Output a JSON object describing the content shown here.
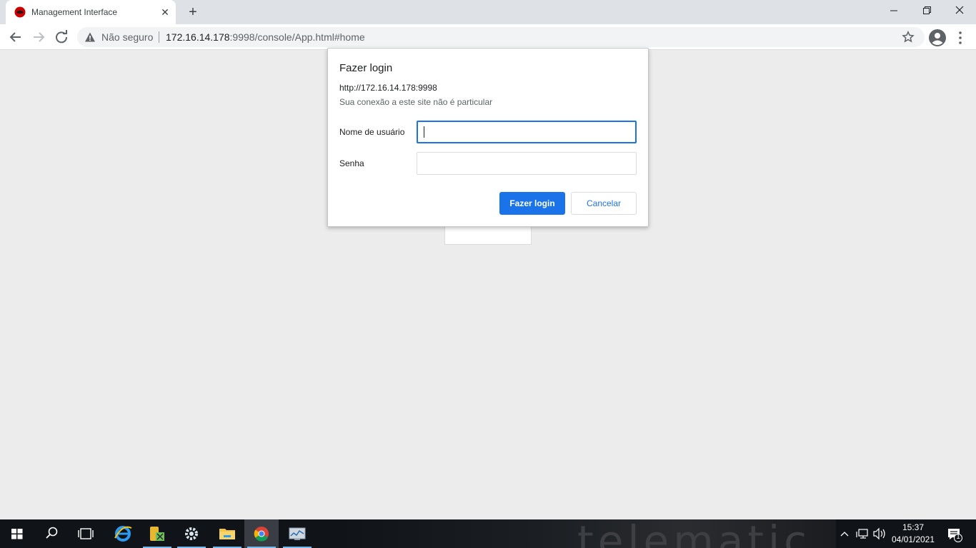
{
  "browser": {
    "tab": {
      "title": "Management Interface",
      "close": "✕"
    },
    "new_tab": "+",
    "window_controls": {
      "minimize": "minimize-icon",
      "maximize": "restore-icon",
      "close": "close-icon"
    },
    "omnibox": {
      "security_label": "Não seguro",
      "url_host": "172.16.14.178",
      "url_rest": ":9998/console/App.html#home"
    }
  },
  "dialog": {
    "title": "Fazer login",
    "origin": "http://172.16.14.178:9998",
    "note": "Sua conexão a este site não é particular",
    "username_label": "Nome de usuário",
    "username_value": "",
    "password_label": "Senha",
    "password_value": "",
    "login_button": "Fazer login",
    "cancel_button": "Cancelar"
  },
  "taskbar": {
    "wallpaper_text": "telematic",
    "time": "15:37",
    "date": "04/01/2021",
    "notification_count": "1",
    "apps": [
      "windows-start-icon",
      "search-icon",
      "task-view-icon",
      "internet-explorer-icon",
      "server-manager-icon",
      "settings-gear-icon",
      "file-explorer-icon",
      "chrome-icon",
      "performance-monitor-icon"
    ]
  },
  "colors": {
    "accent": "#1a73e8",
    "page_background": "#ececec",
    "taskbar": "#101418"
  }
}
